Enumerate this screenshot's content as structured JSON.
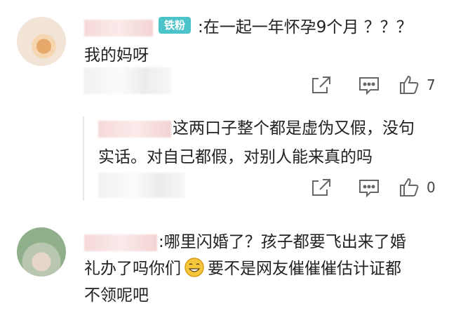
{
  "comments": [
    {
      "badge": "铁粉",
      "line1": ":在一起一年怀孕9个月 ？？？",
      "line2": "我的妈呀",
      "like_count": "7"
    },
    {
      "reply_line1": "这两口子整个都是虚伪又假，没句",
      "reply_line2": "实话。对自己都假，对别人能来真的吗",
      "like_count": "0"
    },
    {
      "line1": ":哪里闪婚了？孩子都要飞出来了婚",
      "line2_pre": "礼办了吗你们",
      "line2_post": "要不是网友催催催估计证都",
      "line3": "不领呢吧"
    }
  ]
}
